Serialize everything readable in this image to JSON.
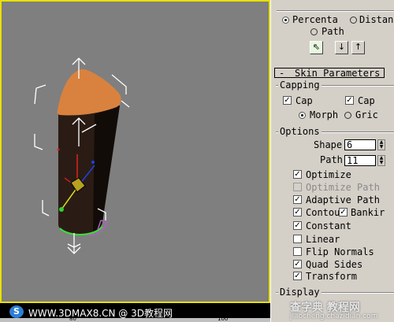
{
  "path_params": {
    "percentage_label": "Percenta",
    "distance_label": "Distan",
    "path_steps_label": "Path",
    "pick_shape_btn": "⇖",
    "prev_shape_btn": "↓",
    "next_shape_btn": "↑"
  },
  "skin_parameters": {
    "rollout_sign": "-",
    "rollout_title": "Skin Parameters",
    "capping": {
      "title": "Capping",
      "cap_start_label": "Cap",
      "cap_end_label": "Cap",
      "morph_label": "Morph",
      "grid_label": "Gric"
    },
    "options": {
      "title": "Options",
      "shape_steps_label": "Shape",
      "shape_steps_value": "6",
      "path_steps_label": "Path",
      "path_steps_value": "11",
      "checkboxes": [
        {
          "label": "Optimize",
          "checked": true,
          "disabled": false
        },
        {
          "label": "Optimize Path",
          "checked": false,
          "disabled": true
        },
        {
          "label": "Adaptive Path",
          "checked": true,
          "disabled": false
        },
        {
          "label": "Contou",
          "checked": true,
          "disabled": false
        },
        {
          "label": "Bankir",
          "checked": true,
          "disabled": false
        },
        {
          "label": "Constant",
          "checked": true,
          "disabled": false
        },
        {
          "label": "Linear",
          "checked": false,
          "disabled": false
        },
        {
          "label": "Flip Normals",
          "checked": false,
          "disabled": false
        },
        {
          "label": "Quad Sides",
          "checked": true,
          "disabled": false
        },
        {
          "label": "Transform",
          "checked": true,
          "disabled": false
        }
      ]
    },
    "display": {
      "title": "Display"
    }
  },
  "banner": {
    "logo_glyph": "S",
    "text": "WWW.3DMAX8.CN @ 3D教程网",
    "ruler_ticks": [
      "80",
      "100"
    ]
  },
  "watermark": {
    "line1": "查字典 教程网",
    "line2": "jiaocheng.chazidian.com"
  },
  "colors": {
    "viewport_bg": "#7f7f7f",
    "panel_bg": "#d4d0c8",
    "object_cap": "#d9823f",
    "object_body": "#2a1c14"
  }
}
